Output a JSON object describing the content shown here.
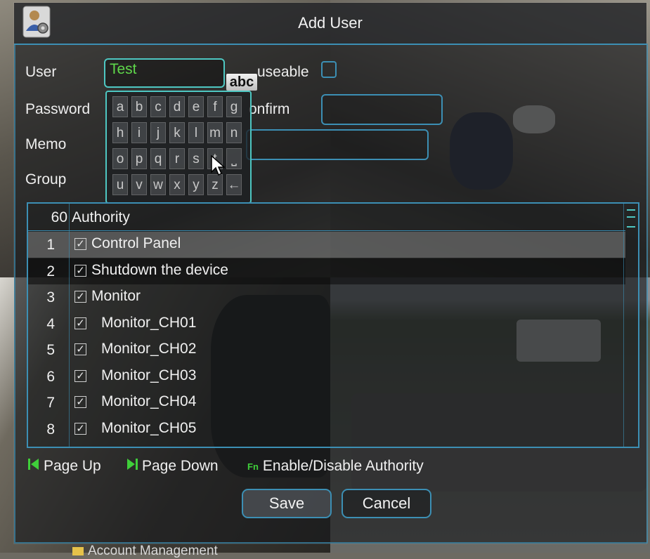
{
  "window": {
    "title": "Add User",
    "icon": "user-settings-icon"
  },
  "form": {
    "user_label": "User",
    "user_value": "Test",
    "input_mode": "abc",
    "useable_label": "useable",
    "useable_checked": false,
    "password_label": "Password",
    "confirm_label": "onfirm",
    "memo_label": "Memo",
    "group_label": "Group"
  },
  "keyboard": {
    "rows": [
      [
        "a",
        "b",
        "c",
        "d",
        "e",
        "f",
        "g"
      ],
      [
        "h",
        "i",
        "j",
        "k",
        "l",
        "m",
        "n"
      ],
      [
        "o",
        "p",
        "q",
        "r",
        "s",
        "t",
        "⎵"
      ],
      [
        "u",
        "v",
        "w",
        "x",
        "y",
        "z",
        "←"
      ]
    ]
  },
  "authority_table": {
    "count": "60",
    "header": "Authority",
    "rows": [
      {
        "num": "1",
        "label": "Control Panel",
        "checked": true,
        "indent": 0,
        "selected": true
      },
      {
        "num": "2",
        "label": "Shutdown the device",
        "checked": true,
        "indent": 0
      },
      {
        "num": "3",
        "label": "Monitor",
        "checked": true,
        "indent": 0
      },
      {
        "num": "4",
        "label": "Monitor_CH01",
        "checked": true,
        "indent": 1
      },
      {
        "num": "5",
        "label": "Monitor_CH02",
        "checked": true,
        "indent": 1
      },
      {
        "num": "6",
        "label": "Monitor_CH03",
        "checked": true,
        "indent": 1
      },
      {
        "num": "7",
        "label": "Monitor_CH04",
        "checked": true,
        "indent": 1
      },
      {
        "num": "8",
        "label": "Monitor_CH05",
        "checked": true,
        "indent": 1
      }
    ]
  },
  "hints": {
    "page_up": "Page Up",
    "page_down": "Page Down",
    "fn_key": "Fn",
    "enable_disable": "Enable/Disable Authority"
  },
  "buttons": {
    "save": "Save",
    "cancel": "Cancel"
  },
  "background_menu": {
    "item": "Account Management"
  },
  "colors": {
    "border": "#3c8fb4",
    "active_border": "#4ec7c2",
    "value_text": "#5fd84a",
    "hint_icon": "#3fcf3a"
  }
}
